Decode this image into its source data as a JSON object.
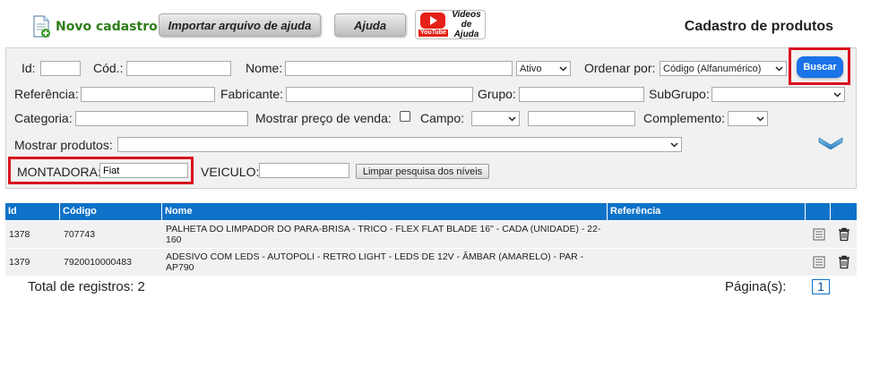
{
  "toolbar": {
    "novo_label": "Novo cadastro",
    "importar_label": "Importar arquivo de ajuda",
    "ajuda_label": "Ajuda",
    "youtube_label": "YouTube",
    "videos_label_1": "Videos",
    "videos_label_2": "de Ajuda"
  },
  "page_title": "Cadastro de produtos",
  "filters": {
    "id_label": "Id:",
    "id_value": "",
    "cod_label": "Cód.:",
    "cod_value": "",
    "nome_label": "Nome:",
    "nome_value": "",
    "status_value": "Ativo",
    "ordenar_label": "Ordenar por:",
    "ordenar_value": "Código (Alfanumérico)",
    "buscar_label": "Buscar",
    "referencia_label": "Referência:",
    "referencia_value": "",
    "fabricante_label": "Fabricante:",
    "fabricante_value": "",
    "grupo_label": "Grupo:",
    "grupo_value": "",
    "subgrupo_label": "SubGrupo:",
    "subgrupo_value": "",
    "categoria_label": "Categoria:",
    "categoria_value": "",
    "mostrar_preco_label": "Mostrar preço de venda:",
    "campo_label": "Campo:",
    "campo_value": "",
    "campo_text_value": "",
    "complemento_label": "Complemento:",
    "complemento_value": "",
    "mostrar_produtos_label": "Mostrar produtos:",
    "mostrar_produtos_value": "",
    "montadora_label": "MONTADORA:",
    "montadora_value": "Fiat",
    "veiculo_label": "VEICULO:",
    "veiculo_value": "",
    "limpar_label": "Limpar pesquisa dos níveis"
  },
  "table": {
    "headers": {
      "id": "Id",
      "codigo": "Código",
      "nome": "Nome",
      "referencia": "Referência"
    },
    "rows": [
      {
        "id": "1378",
        "codigo": "707743",
        "nome": "PALHETA DO LIMPADOR DO PARA-BRISA - TRICO - FLEX FLAT BLADE 16\" - CADA (UNIDADE) - 22-160",
        "referencia": ""
      },
      {
        "id": "1379",
        "codigo": "7920010000483",
        "nome": "ADESIVO COM LEDS - AUTOPOLI - RETRO LIGHT - LEDS DE 12V - ÂMBAR (AMARELO) - PAR - AP790",
        "referencia": ""
      }
    ]
  },
  "footer": {
    "total_label": "Total de registros: 2",
    "paginas_label": "Página(s):",
    "page_number": "1"
  },
  "colors": {
    "accent": "#0e72c8",
    "highlight": "#d9121f",
    "button": "#1a73e8",
    "novo": "#2e7d1a"
  }
}
